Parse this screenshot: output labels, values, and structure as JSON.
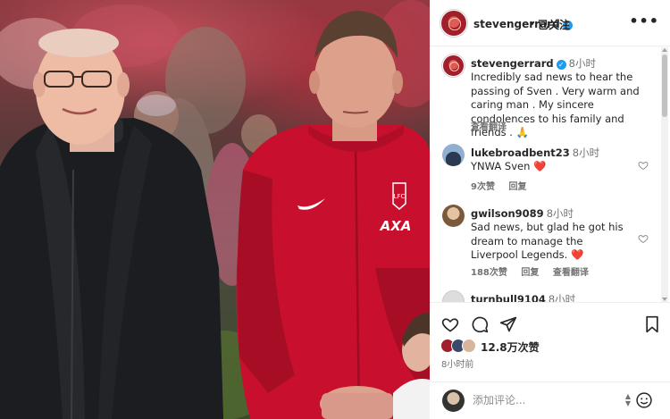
{
  "post": {
    "username": "stevengerrard",
    "dot": "•",
    "follow_label": "已关注",
    "more_label": "•••"
  },
  "caption": {
    "username": "stevengerrard",
    "time": "8小时",
    "text": "Incredibly sad news to hear the passing of Sven . Very warm and caring man . My sincere condolences to his family and friends . 🙏",
    "translate_label": "查看翻译"
  },
  "comments": [
    {
      "username": "lukebroadbent23",
      "time": "8小时",
      "text": "YNWA Sven ❤️",
      "likes": "9次赞",
      "reply_label": "回复",
      "translate_label": ""
    },
    {
      "username": "gwilson9089",
      "time": "8小时",
      "text": "Sad news, but glad he got his dream to manage the Liverpool Legends. ❤️",
      "likes": "188次赞",
      "reply_label": "回复",
      "translate_label": "查看翻译"
    },
    {
      "username": "turnbull9104",
      "time": "8小时",
      "text": "",
      "likes": "",
      "reply_label": "",
      "translate_label": ""
    }
  ],
  "actions": {
    "likes_count": "12.8万次赞",
    "time_ago": "8小时前"
  },
  "add_comment": {
    "placeholder": "添加评论...",
    "stepper_up": "▲",
    "stepper_down": "▼"
  },
  "icons": {
    "header_avatar": "lfc-crest-avatar-icon",
    "heart": "heart-icon",
    "comment": "comment-icon",
    "share": "share-icon",
    "save": "bookmark-icon",
    "emoji": "emoji-icon"
  },
  "colors": {
    "verified": "#1d9bf0",
    "heart_red": "#ed4956",
    "liverpool_red": "#c8102e",
    "muted_text": "#737373"
  }
}
